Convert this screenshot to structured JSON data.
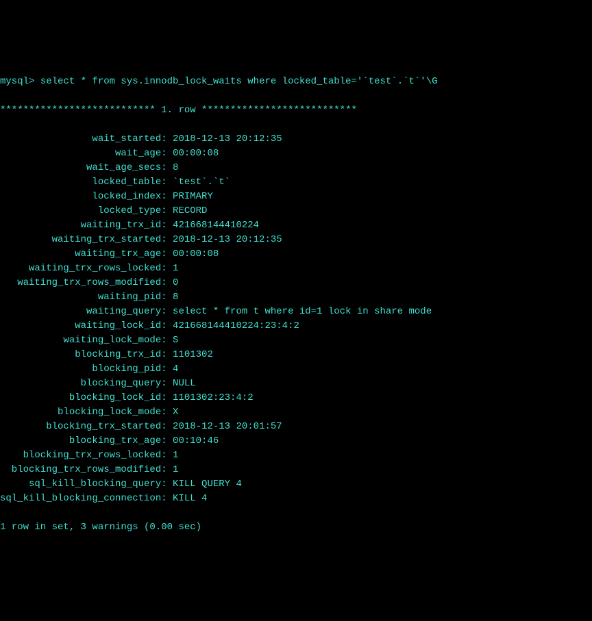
{
  "prompt": "mysql> ",
  "query": "select * from sys.innodb_lock_waits where locked_table='`test`.`t`'\\G",
  "row_header": "*************************** 1. row ***************************",
  "fields": [
    {
      "name": "wait_started",
      "value": "2018-12-13 20:12:35"
    },
    {
      "name": "wait_age",
      "value": "00:00:08"
    },
    {
      "name": "wait_age_secs",
      "value": "8"
    },
    {
      "name": "locked_table",
      "value": "`test`.`t`"
    },
    {
      "name": "locked_index",
      "value": "PRIMARY"
    },
    {
      "name": "locked_type",
      "value": "RECORD"
    },
    {
      "name": "waiting_trx_id",
      "value": "421668144410224"
    },
    {
      "name": "waiting_trx_started",
      "value": "2018-12-13 20:12:35"
    },
    {
      "name": "waiting_trx_age",
      "value": "00:00:08"
    },
    {
      "name": "waiting_trx_rows_locked",
      "value": "1"
    },
    {
      "name": "waiting_trx_rows_modified",
      "value": "0"
    },
    {
      "name": "waiting_pid",
      "value": "8"
    },
    {
      "name": "waiting_query",
      "value": "select * from t where id=1 lock in share mode"
    },
    {
      "name": "waiting_lock_id",
      "value": "421668144410224:23:4:2"
    },
    {
      "name": "waiting_lock_mode",
      "value": "S"
    },
    {
      "name": "blocking_trx_id",
      "value": "1101302"
    },
    {
      "name": "blocking_pid",
      "value": "4"
    },
    {
      "name": "blocking_query",
      "value": "NULL"
    },
    {
      "name": "blocking_lock_id",
      "value": "1101302:23:4:2"
    },
    {
      "name": "blocking_lock_mode",
      "value": "X"
    },
    {
      "name": "blocking_trx_started",
      "value": "2018-12-13 20:01:57"
    },
    {
      "name": "blocking_trx_age",
      "value": "00:10:46"
    },
    {
      "name": "blocking_trx_rows_locked",
      "value": "1"
    },
    {
      "name": "blocking_trx_rows_modified",
      "value": "1"
    },
    {
      "name": "sql_kill_blocking_query",
      "value": "KILL QUERY 4"
    },
    {
      "name": "sql_kill_blocking_connection",
      "value": "KILL 4"
    }
  ],
  "summary": "1 row in set, 3 warnings (0.00 sec)"
}
